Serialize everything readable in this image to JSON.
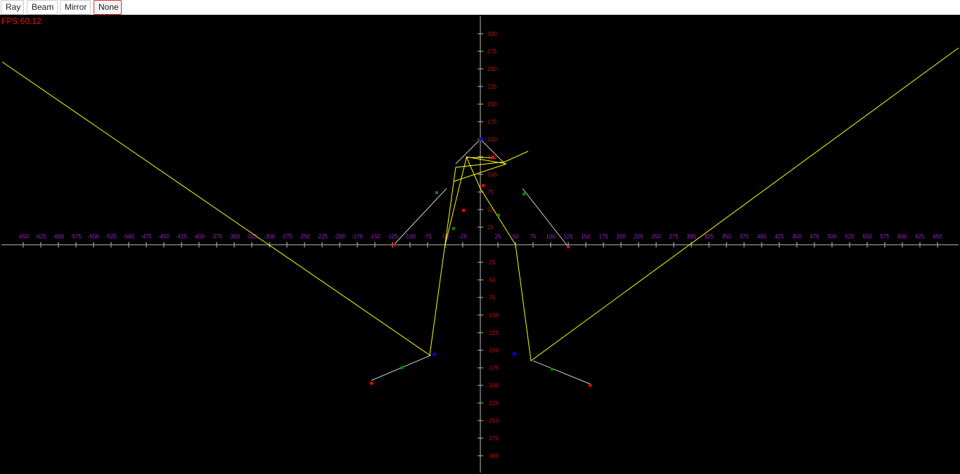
{
  "toolbar": {
    "buttons": [
      {
        "label": "Ray",
        "active": false
      },
      {
        "label": "Beam",
        "active": false
      },
      {
        "label": "Mirror",
        "active": false
      },
      {
        "label": "None",
        "active": true
      }
    ]
  },
  "fps_label": "FPS:60.12",
  "chart_data": {
    "type": "scatter",
    "title": "",
    "xlabel": "",
    "ylabel": "",
    "xlim": [
      -650,
      650
    ],
    "ylim": [
      -300,
      300
    ],
    "x_ticks_step": 25,
    "y_ticks_step": 25,
    "colors": {
      "background": "#000000",
      "axes": "#bbbbbb",
      "x_tick_labels": "#a020d0",
      "y_tick_labels": "#cc1111",
      "ray": "#ffff00",
      "mirror": "#cccccc",
      "endpoint": "#ff0000",
      "midpoint": "#008800",
      "source": "#0000ff"
    },
    "mirrors": [
      {
        "p1": [
          -48,
          80
        ],
        "p2": [
          -123,
          0
        ]
      },
      {
        "p1": [
          -35,
          115
        ],
        "p2": [
          0,
          150
        ]
      },
      {
        "p1": [
          0,
          150
        ],
        "p2": [
          35,
          115
        ]
      },
      {
        "p1": [
          60,
          80
        ],
        "p2": [
          125,
          -3
        ]
      },
      {
        "p1": [
          -70,
          -157
        ],
        "p2": [
          -155,
          -193
        ]
      },
      {
        "p1": [
          75,
          -165
        ],
        "p2": [
          156,
          -198
        ]
      }
    ],
    "rays": [
      {
        "points": [
          [
            -680,
            260
          ],
          [
            -72,
            -157
          ],
          [
            -35,
            110
          ],
          [
            35,
            118
          ],
          [
            68,
            133
          ]
        ]
      },
      {
        "points": [
          [
            -50,
            0
          ],
          [
            -20,
            123
          ],
          [
            -19,
            124
          ],
          [
            18,
            124
          ]
        ]
      },
      {
        "points": [
          [
            -38,
            90
          ],
          [
            37,
            115
          ],
          [
            -20,
            125
          ],
          [
            0,
            80
          ],
          [
            50,
            0
          ],
          [
            72,
            -165
          ],
          [
            680,
            280
          ]
        ]
      }
    ],
    "endpoints": [
      [
        -123,
        0
      ],
      [
        125,
        -3
      ],
      [
        -155,
        -197
      ],
      [
        156,
        -200
      ],
      [
        -24,
        49
      ],
      [
        4,
        84
      ],
      [
        18,
        124
      ]
    ],
    "midpoints": [
      [
        -62,
        74
      ],
      [
        62,
        72
      ],
      [
        -112,
        -175
      ],
      [
        102,
        -177
      ],
      [
        -38,
        23
      ],
      [
        26,
        42
      ]
    ],
    "sources": [
      [
        0,
        150
      ],
      [
        -66,
        -156
      ],
      [
        48,
        -155
      ]
    ]
  }
}
